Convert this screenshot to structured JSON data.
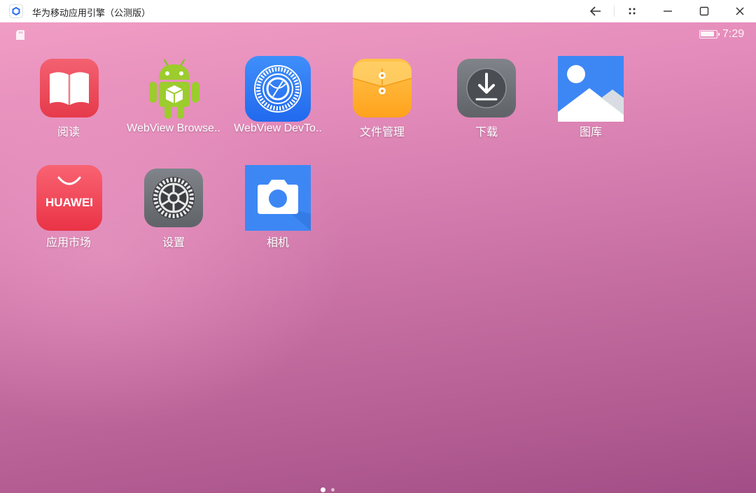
{
  "window": {
    "title": "华为移动应用引擎（公测版）",
    "controls": [
      "back-icon",
      "grid-dots-icon",
      "minimize-icon",
      "maximize-icon",
      "close-icon"
    ]
  },
  "status_bar": {
    "time": "7:29",
    "battery_level": 0.9,
    "left_icon": "sd-card-icon"
  },
  "apps": [
    {
      "label": "阅读",
      "icon": "book-icon",
      "color": "#ef4655"
    },
    {
      "label": "WebView Browse..",
      "icon": "android-robot-icon",
      "color": "#9ccc2d"
    },
    {
      "label": "WebView DevTo..",
      "icon": "webview-gear-icon",
      "color": "#2f7ef5"
    },
    {
      "label": "文件管理",
      "icon": "folder-icon",
      "color": "#ffb02e"
    },
    {
      "label": "下载",
      "icon": "download-icon",
      "color": "#6d7073"
    },
    {
      "label": "图库",
      "icon": "gallery-icon",
      "color": "#3d87f5"
    },
    {
      "label": "应用市场",
      "icon": "huawei-appgallery-icon",
      "color": "#f0404f",
      "brand_text": "HUAWEI"
    },
    {
      "label": "设置",
      "icon": "settings-gear-icon",
      "color": "#6d7073"
    },
    {
      "label": "相机",
      "icon": "camera-icon",
      "color": "#3d87f5"
    }
  ],
  "page_indicator": {
    "pages": 2,
    "current": 1
  }
}
